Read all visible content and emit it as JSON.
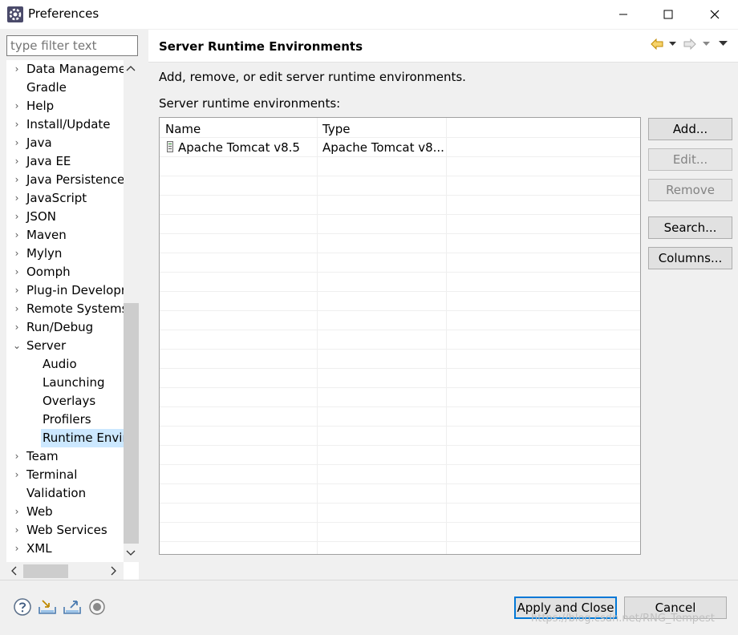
{
  "window": {
    "title": "Preferences"
  },
  "filter": {
    "placeholder": "type filter text"
  },
  "tree": {
    "items": [
      {
        "label": "Data Manageme",
        "expander": "›",
        "child": false
      },
      {
        "label": "Gradle",
        "expander": "",
        "child": false
      },
      {
        "label": "Help",
        "expander": "›",
        "child": false
      },
      {
        "label": "Install/Update",
        "expander": "›",
        "child": false
      },
      {
        "label": "Java",
        "expander": "›",
        "child": false
      },
      {
        "label": "Java EE",
        "expander": "›",
        "child": false
      },
      {
        "label": "Java Persistence",
        "expander": "›",
        "child": false
      },
      {
        "label": "JavaScript",
        "expander": "›",
        "child": false
      },
      {
        "label": "JSON",
        "expander": "›",
        "child": false
      },
      {
        "label": "Maven",
        "expander": "›",
        "child": false
      },
      {
        "label": "Mylyn",
        "expander": "›",
        "child": false
      },
      {
        "label": "Oomph",
        "expander": "›",
        "child": false
      },
      {
        "label": "Plug-in Developr",
        "expander": "›",
        "child": false
      },
      {
        "label": "Remote Systems",
        "expander": "›",
        "child": false
      },
      {
        "label": "Run/Debug",
        "expander": "›",
        "child": false
      },
      {
        "label": "Server",
        "expander": "⌄",
        "child": false
      },
      {
        "label": "Audio",
        "expander": "",
        "child": true
      },
      {
        "label": "Launching",
        "expander": "",
        "child": true
      },
      {
        "label": "Overlays",
        "expander": "",
        "child": true
      },
      {
        "label": "Profilers",
        "expander": "",
        "child": true
      },
      {
        "label": "Runtime Envir",
        "expander": "",
        "child": true,
        "selected": true
      },
      {
        "label": "Team",
        "expander": "›",
        "child": false
      },
      {
        "label": "Terminal",
        "expander": "›",
        "child": false
      },
      {
        "label": "Validation",
        "expander": "",
        "child": false
      },
      {
        "label": "Web",
        "expander": "›",
        "child": false
      },
      {
        "label": "Web Services",
        "expander": "›",
        "child": false
      },
      {
        "label": "XML",
        "expander": "›",
        "child": false
      }
    ]
  },
  "page": {
    "title": "Server Runtime Environments",
    "description": "Add, remove, or edit server runtime environments.",
    "list_label": "Server runtime environments:"
  },
  "table": {
    "headers": [
      "Name",
      "Type"
    ],
    "rows": [
      {
        "name": "Apache Tomcat v8.5",
        "type": "Apache Tomcat v8..."
      }
    ]
  },
  "side_buttons": {
    "add": "Add...",
    "edit": "Edit...",
    "remove": "Remove",
    "search": "Search...",
    "columns": "Columns..."
  },
  "footer": {
    "apply_close": "Apply and Close",
    "cancel": "Cancel",
    "watermark": "https://blog.csdn.net/RNG_Tempest"
  },
  "colors": {
    "selection": "#cce8ff",
    "accent": "#0078d7",
    "back_arrow": "#e0a000"
  }
}
